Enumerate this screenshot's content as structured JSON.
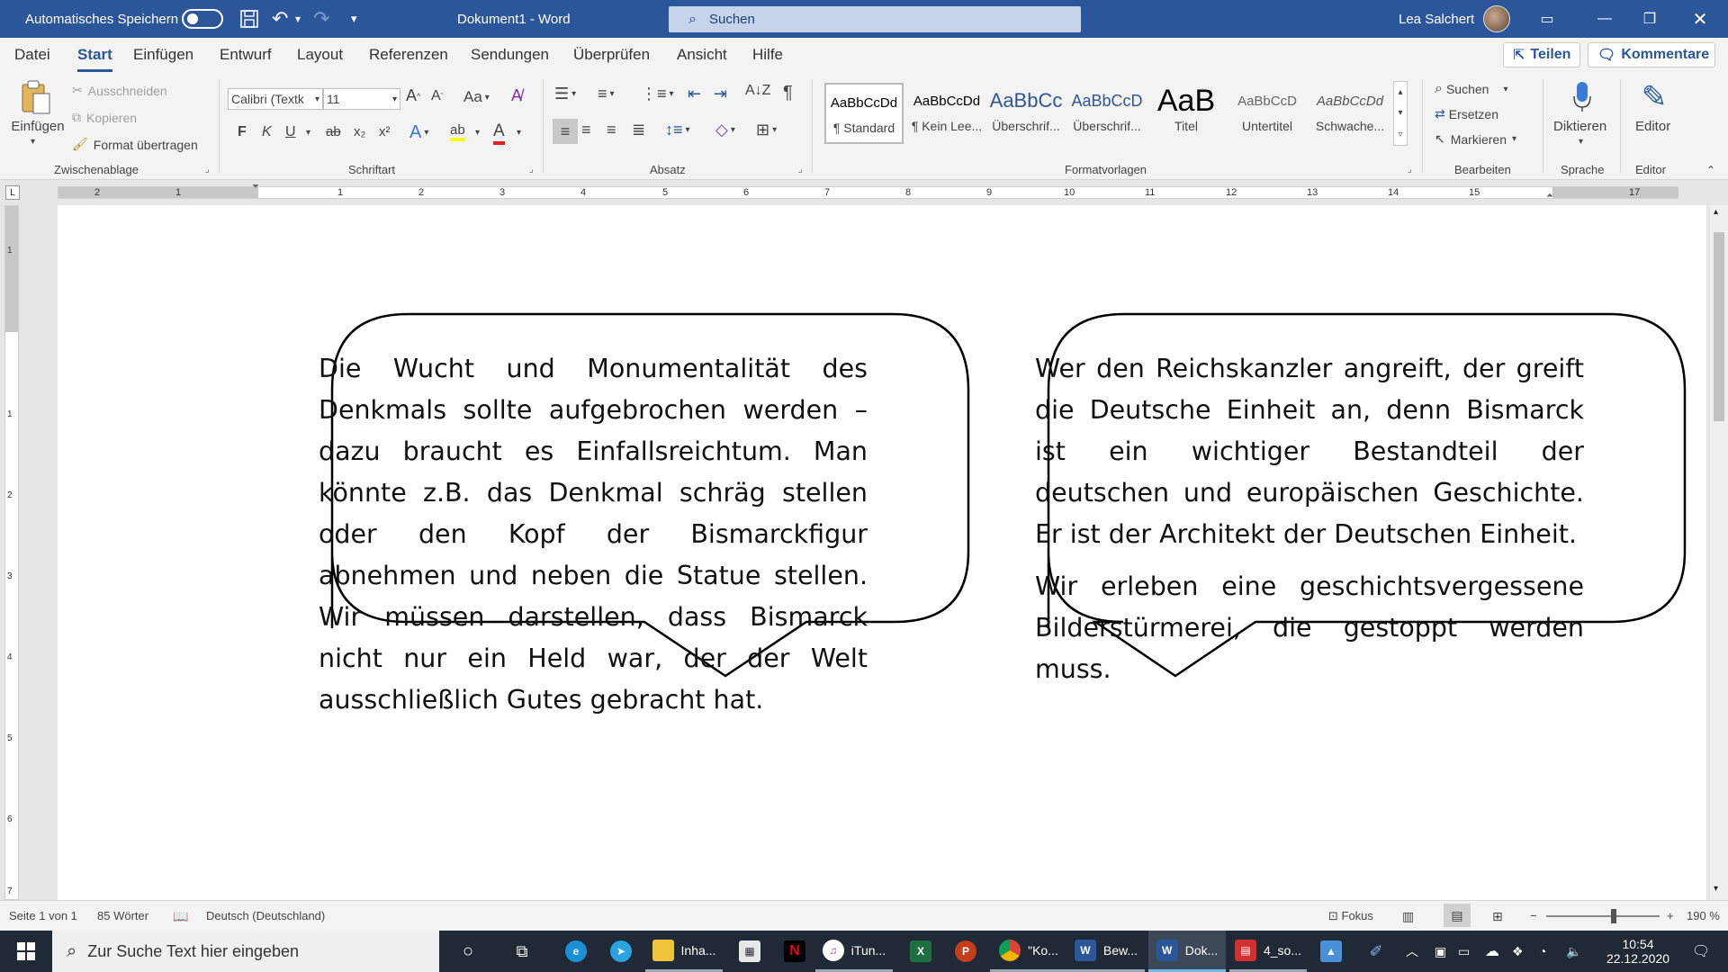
{
  "window": {
    "autosave_label": "Automatisches Speichern",
    "doc_title": "Dokument1  -  Word",
    "search_placeholder": "Suchen",
    "user_name": "Lea Salchert"
  },
  "menu": {
    "tabs": [
      "Datei",
      "Start",
      "Einfügen",
      "Entwurf",
      "Layout",
      "Referenzen",
      "Sendungen",
      "Überprüfen",
      "Ansicht",
      "Hilfe"
    ],
    "active_tab": "Start",
    "share_label": "Teilen",
    "comments_label": "Kommentare"
  },
  "ribbon": {
    "clipboard": {
      "paste_label": "Einfügen",
      "cut_label": "Ausschneiden",
      "copy_label": "Kopieren",
      "format_painter_label": "Format übertragen",
      "group_label": "Zwischenablage"
    },
    "font": {
      "font_name": "Calibri (Textk",
      "font_size": "11",
      "group_label": "Schriftart",
      "bold": "F",
      "italic": "K",
      "underline": "U",
      "strikethrough": "ab",
      "subscript": "x₂",
      "superscript": "x²",
      "text_effects": "A",
      "highlight": "ab",
      "font_color": "A",
      "change_case": "Aa",
      "grow": "A",
      "shrink": "A"
    },
    "paragraph": {
      "group_label": "Absatz"
    },
    "styles": {
      "group_label": "Formatvorlagen",
      "items": [
        {
          "sample": "AaBbCcDd",
          "name": "¶ Standard"
        },
        {
          "sample": "AaBbCcDd",
          "name": "¶ Kein Lee..."
        },
        {
          "sample": "AaBbCc",
          "name": "Überschrif..."
        },
        {
          "sample": "AaBbCcD",
          "name": "Überschrif..."
        },
        {
          "sample": "AaB",
          "name": "Titel"
        },
        {
          "sample": "AaBbCcD",
          "name": "Untertitel"
        },
        {
          "sample": "AaBbCcDd",
          "name": "Schwache..."
        }
      ]
    },
    "editing": {
      "find_label": "Suchen",
      "replace_label": "Ersetzen",
      "select_label": "Markieren",
      "group_label": "Bearbeiten"
    },
    "voice": {
      "dictate_label": "Diktieren",
      "group_label": "Sprache"
    },
    "editor": {
      "editor_label": "Editor",
      "group_label": "Editor"
    }
  },
  "ruler": {
    "numbers": [
      "2",
      "1",
      "1",
      "2",
      "3",
      "4",
      "5",
      "6",
      "7",
      "8",
      "9",
      "10",
      "11",
      "12",
      "13",
      "14",
      "15",
      "17"
    ]
  },
  "vruler": {
    "numbers": [
      "1",
      "1",
      "2",
      "3",
      "4",
      "5",
      "6",
      "7"
    ]
  },
  "document": {
    "bubble_left": {
      "paragraphs": [
        "Die Wucht und Monumentalität des Denkmals sollte aufgebrochen werden – dazu braucht es Einfallsreichtum. Man könnte z.B. das Denkmal schräg stellen oder den Kopf der Bismarckfigur abnehmen und neben die Statue stellen. Wir müssen darstellen, dass Bismarck nicht nur ein Held war, der der Welt ausschließlich Gutes gebracht hat."
      ]
    },
    "bubble_right": {
      "paragraphs": [
        "Wer den Reichskanzler angreift, der greift die Deutsche Einheit an, denn Bismarck ist ein wichtiger Bestandteil der deutschen und europäischen Geschichte. Er ist der Architekt der Deutschen Einheit.",
        "Wir erleben eine geschichtsvergessene Bilderstürmerei, die gestoppt werden muss."
      ]
    }
  },
  "status": {
    "page": "Seite 1 von 1",
    "words": "85 Wörter",
    "language": "Deutsch (Deutschland)",
    "focus": "Fokus",
    "zoom": "190 %",
    "zoom_minus": "−",
    "zoom_plus": "+"
  },
  "taskbar": {
    "search_placeholder": "Zur Suche Text hier eingeben",
    "apps": [
      {
        "icon": "edge-icon",
        "label": ""
      },
      {
        "icon": "telegram-icon",
        "label": ""
      },
      {
        "icon": "folder-icon",
        "label": "Inha..."
      },
      {
        "icon": "store-icon",
        "label": ""
      },
      {
        "icon": "netflix-icon",
        "label": ""
      },
      {
        "icon": "itunes-icon",
        "label": "iTun..."
      },
      {
        "icon": "excel-icon",
        "label": ""
      },
      {
        "icon": "powerpoint-icon",
        "label": ""
      },
      {
        "icon": "chrome-icon",
        "label": "\"Ko..."
      },
      {
        "icon": "word-icon",
        "label": "Bew..."
      },
      {
        "icon": "word-icon",
        "label": "Dok..."
      },
      {
        "icon": "pdf-icon",
        "label": "4_so..."
      },
      {
        "icon": "photos-icon",
        "label": ""
      },
      {
        "icon": "pen-icon",
        "label": ""
      }
    ],
    "time": "10:54",
    "date": "22.12.2020"
  },
  "colors": {
    "word_blue": "#2b579a",
    "taskbar": "#1f2a36"
  }
}
